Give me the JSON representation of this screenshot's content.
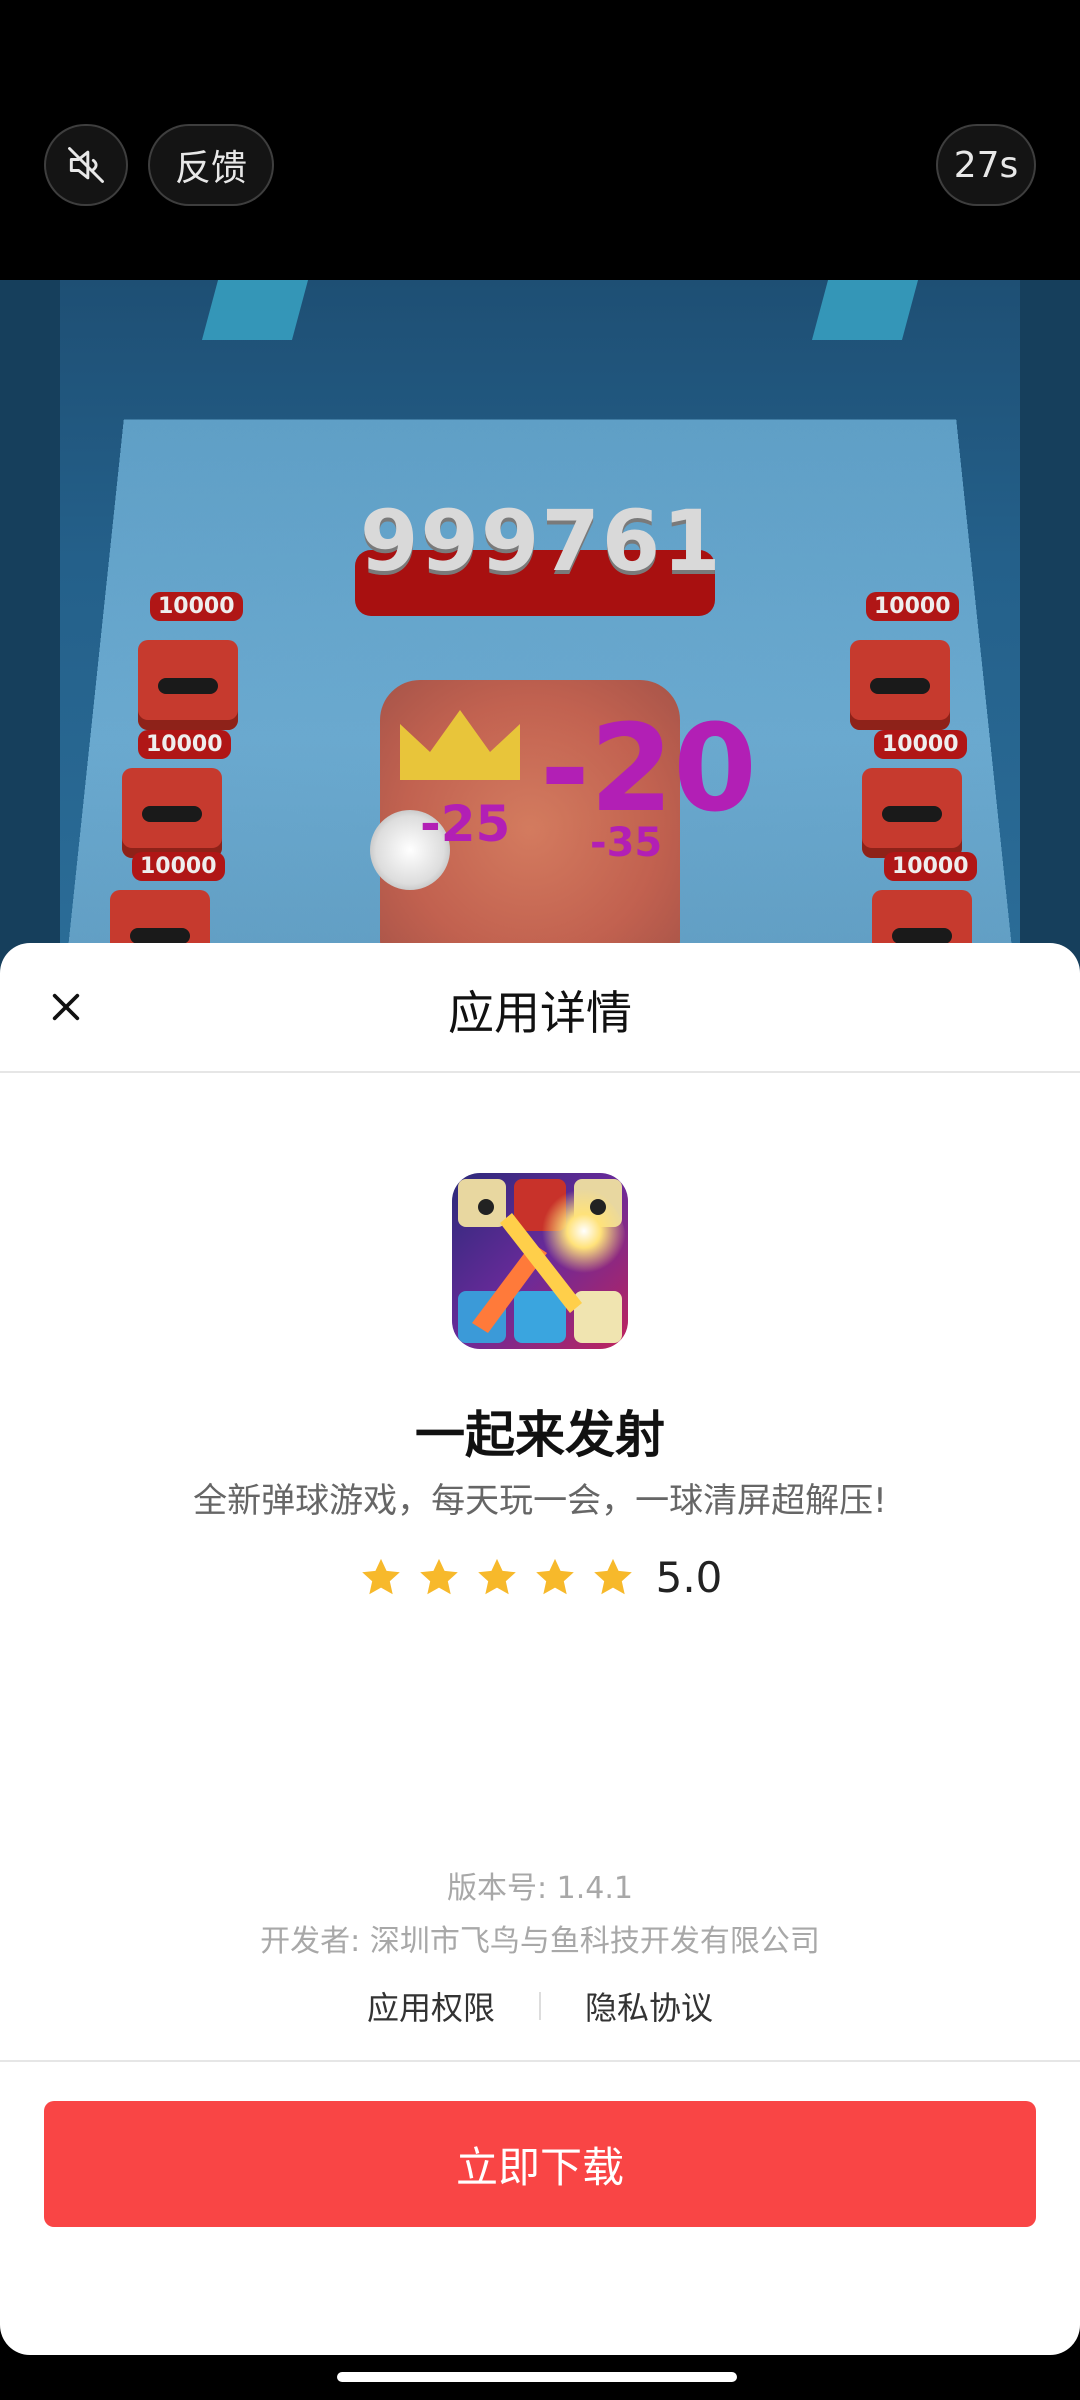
{
  "top_bar": {
    "mute_icon": "speaker-muted-icon",
    "feedback_label": "反馈",
    "timer_label": "27s"
  },
  "game": {
    "score": "999761",
    "tags": [
      "10000",
      "10000",
      "10000",
      "10000",
      "10000",
      "10000"
    ],
    "damage_large": "-20",
    "damage_left": "-25",
    "damage_right": "-35"
  },
  "sheet": {
    "title": "应用详情",
    "close_icon": "close-icon",
    "app": {
      "name": "一起来发射",
      "description": "全新弹球游戏，每天玩一会，一球清屏超解压!",
      "rating": "5.0",
      "stars": 5
    },
    "version": "版本号: 1.4.1",
    "developer": "开发者: 深圳市飞鸟与鱼科技开发有限公司",
    "links": {
      "permissions": "应用权限",
      "privacy": "隐私协议"
    },
    "download_label": "立即下载"
  },
  "colors": {
    "download_button": "#f94545",
    "star": "#f7b92b"
  }
}
